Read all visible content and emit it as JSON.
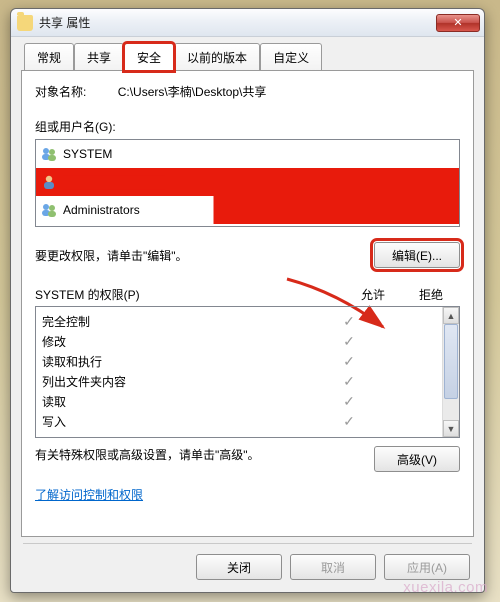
{
  "window": {
    "title": "共享 属性",
    "close_glyph": "✕"
  },
  "tabs": {
    "general": "常规",
    "sharing": "共享",
    "security": "安全",
    "previous": "以前的版本",
    "custom": "自定义"
  },
  "object": {
    "label": "对象名称:",
    "path": "C:\\Users\\李楠\\Desktop\\共享"
  },
  "groups": {
    "label": "组或用户名(G):",
    "items": [
      {
        "name": "SYSTEM",
        "redacted": false
      },
      {
        "name": "████████████",
        "redacted": true
      },
      {
        "name": "Administrators",
        "redacted": false,
        "trail_redacted": true
      }
    ]
  },
  "edit": {
    "text": "要更改权限，请单击\"编辑\"。",
    "button": "编辑(E)..."
  },
  "permissions": {
    "title": "SYSTEM 的权限(P)",
    "col_allow": "允许",
    "col_deny": "拒绝",
    "rows": [
      {
        "name": "完全控制",
        "allow": true,
        "deny": false
      },
      {
        "name": "修改",
        "allow": true,
        "deny": false
      },
      {
        "name": "读取和执行",
        "allow": true,
        "deny": false
      },
      {
        "name": "列出文件夹内容",
        "allow": true,
        "deny": false
      },
      {
        "name": "读取",
        "allow": true,
        "deny": false
      },
      {
        "name": "写入",
        "allow": true,
        "deny": false
      }
    ]
  },
  "advanced": {
    "text": "有关特殊权限或高级设置，请单击\"高级\"。",
    "button": "高级(V)"
  },
  "link": {
    "text": "了解访问控制和权限"
  },
  "footer": {
    "close": "关闭",
    "cancel": "取消",
    "apply": "应用(A)"
  },
  "watermark": "xuexila.com",
  "colors": {
    "highlight": "#d72a1a",
    "redact": "#e81b0c"
  }
}
